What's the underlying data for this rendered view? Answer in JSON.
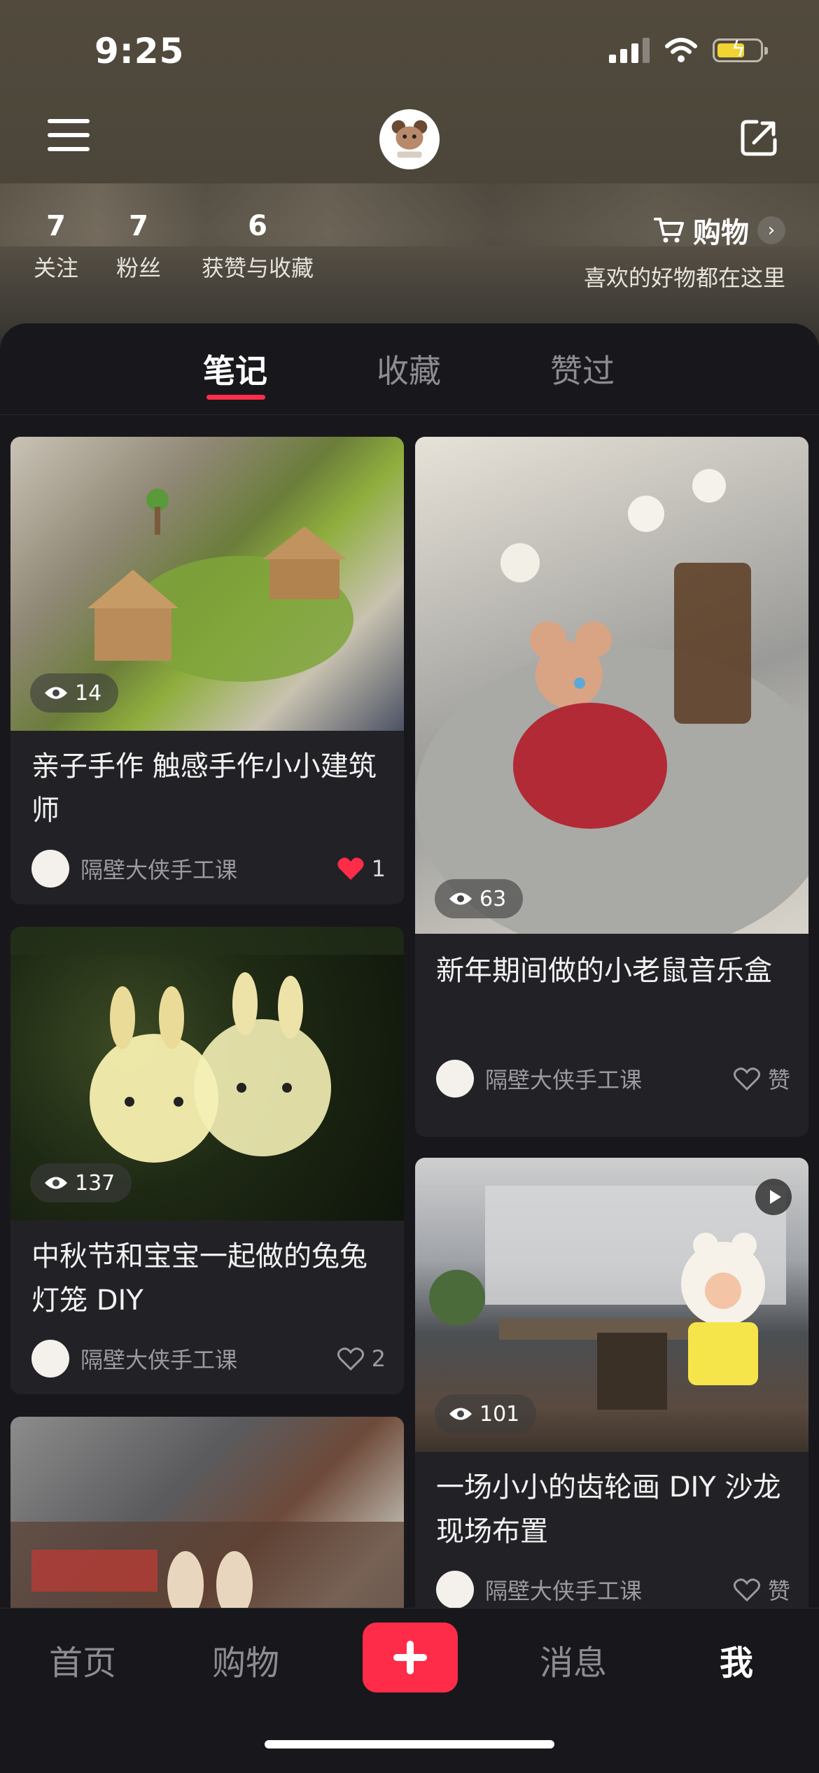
{
  "status": {
    "time": "9:25"
  },
  "profile": {
    "stats": [
      {
        "value": "7",
        "label": "关注"
      },
      {
        "value": "7",
        "label": "粉丝"
      },
      {
        "value": "6",
        "label": "获赞与收藏"
      }
    ],
    "shop": {
      "label": "购物",
      "subtitle": "喜欢的好物都在这里"
    }
  },
  "tabs": [
    {
      "label": "笔记"
    },
    {
      "label": "收藏"
    },
    {
      "label": "赞过"
    }
  ],
  "cards": [
    {
      "views": "14",
      "title": "亲子手作 触感手作小小建筑师",
      "author": "隔壁大侠手工课",
      "like": "1",
      "liked": true
    },
    {
      "views": "63",
      "title": "新年期间做的小老鼠音乐盒",
      "author": "隔壁大侠手工课",
      "like": "赞",
      "liked": false
    },
    {
      "views": "137",
      "title": "中秋节和宝宝一起做的兔兔灯笼 DIY",
      "author": "隔壁大侠手工课",
      "like": "2",
      "liked": false
    },
    {
      "views": "101",
      "title": "一场小小的齿轮画 DIY 沙龙现场布置",
      "author": "隔壁大侠手工课",
      "like": "赞",
      "liked": false,
      "video": true
    }
  ],
  "bottom_nav": [
    {
      "label": "首页"
    },
    {
      "label": "购物"
    },
    {
      "label": "消息"
    },
    {
      "label": "我"
    }
  ],
  "colors": {
    "accent": "#fe2c48",
    "background": "#18181c",
    "card": "#222226"
  },
  "icons": [
    "menu-icon",
    "share-icon",
    "cart-icon",
    "chevron-right-icon",
    "eye-icon",
    "heart-icon",
    "heart-outline-icon",
    "play-icon",
    "plus-icon"
  ]
}
